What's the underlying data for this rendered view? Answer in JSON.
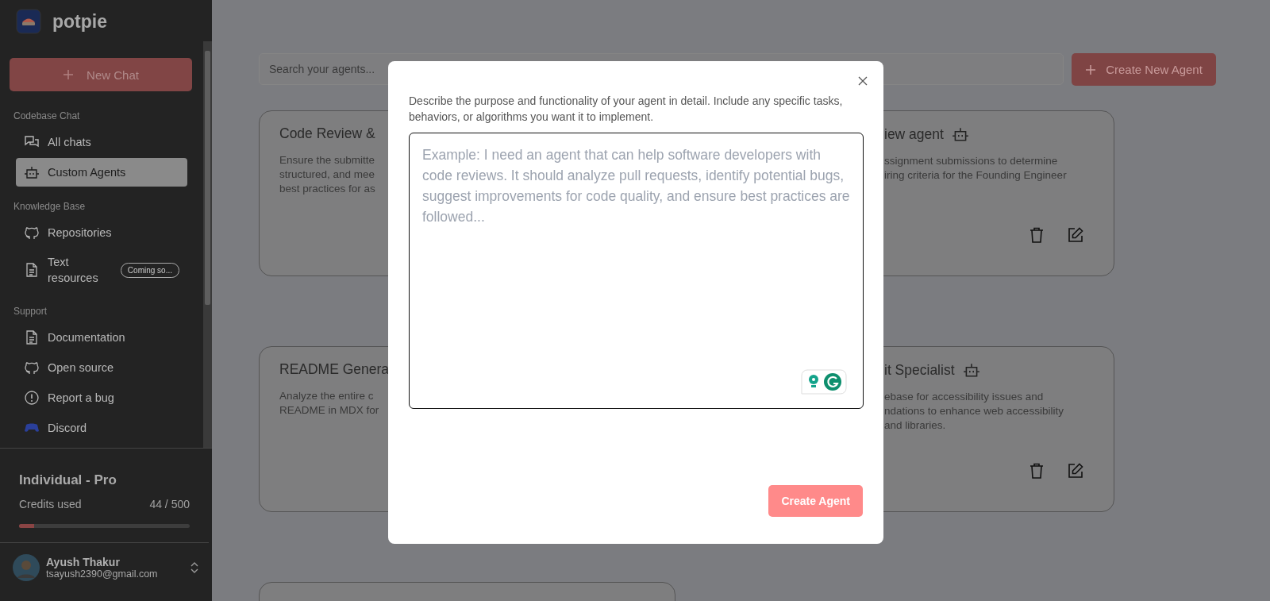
{
  "sidebar": {
    "logo_text": "potpie",
    "new_chat": "New Chat",
    "sections": [
      {
        "title": "Codebase Chat",
        "items": [
          {
            "kind": "chats",
            "label": "All chats",
            "selected": false
          },
          {
            "kind": "robot",
            "label": "Custom Agents",
            "selected": true
          }
        ]
      },
      {
        "title": "Knowledge Base",
        "items": [
          {
            "kind": "repo",
            "label": "Repositories",
            "selected": false
          },
          {
            "kind": "doc",
            "label": "Text resources",
            "selected": false,
            "badge": "Coming so..."
          }
        ]
      },
      {
        "title": "Support",
        "items": [
          {
            "kind": "doc",
            "label": "Documentation",
            "selected": false
          },
          {
            "kind": "repo",
            "label": "Open source",
            "selected": false
          },
          {
            "kind": "alert",
            "label": "Report a bug",
            "selected": false
          },
          {
            "kind": "gamepad",
            "label": "Discord",
            "selected": false
          }
        ]
      }
    ]
  },
  "plan": {
    "name": "Individual - Pro",
    "credits_label": "Credits used",
    "credits_value": "44 / 500",
    "level": 0.088
  },
  "user": {
    "name": "Ayush Thakur",
    "email": "tsayush2390@gmail.com"
  },
  "main": {
    "search": {
      "placeholder": "Search your agents..."
    },
    "create_button": "Create New Agent",
    "cards": [
      {
        "kind": "left",
        "title": "Code Review &",
        "lines": [
          "Ensure the submitte",
          "structured, and mee",
          "best practices for as"
        ]
      },
      {
        "kind": "right",
        "title": "iew agent",
        "lines": [
          "ssignment submissions to determine",
          "iring criteria for the Founding Engineer"
        ]
      },
      {
        "kind": "left",
        "title": "README Genera",
        "lines": [
          "Analyze the entire c",
          "README in MDX for"
        ]
      },
      {
        "kind": "right",
        "title": "it Specialist",
        "lines": [
          "ebase for accessibility issues and",
          "ndations to enhance web accessibility",
          "and libraries."
        ]
      },
      {
        "kind": "left"
      }
    ]
  },
  "modal": {
    "description": "Describe the purpose and functionality of your agent in detail. Include any specific tasks, behaviors, or algorithms you want it to implement.",
    "textarea": {
      "placeholder": "Example: I need an agent that can help software developers with code reviews. It should analyze pull requests, identify potential bugs, suggest improvements for code quality, and ensure best practices are followed..."
    },
    "submit": "Create Agent"
  }
}
